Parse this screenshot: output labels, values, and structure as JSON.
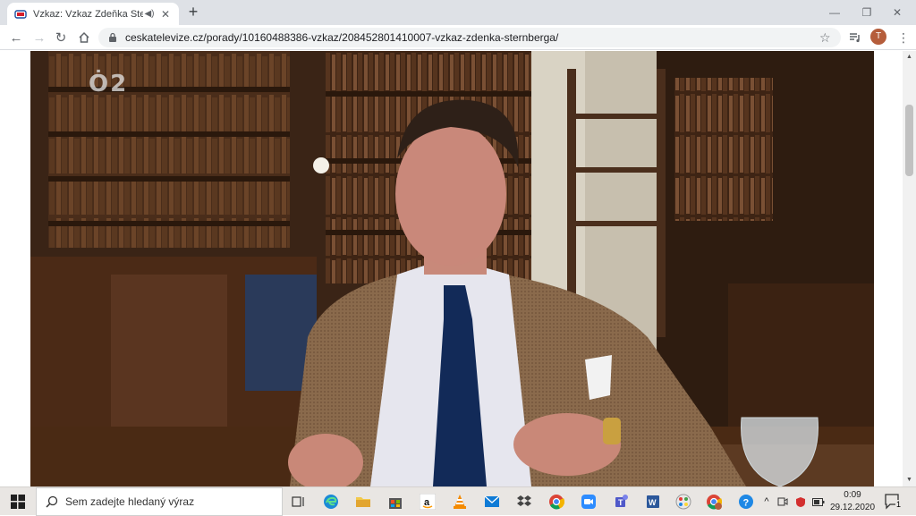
{
  "browser": {
    "tab_title": "Vzkaz: Vzkaz Zdeňka Sternbe",
    "url": "ceskatelevize.cz/porady/10160488386-vzkaz/208452801410007-vzkaz-zdenka-sternberga/",
    "profile_initial": "T",
    "window_controls": [
      "minimize-icon",
      "restore-icon",
      "close-icon"
    ]
  },
  "video": {
    "channel_logo": "Ȯ2"
  },
  "taskbar": {
    "search_placeholder": "Sem zadejte hledaný výraz",
    "apps": [
      "task-view-icon",
      "edge-icon",
      "file-explorer-icon",
      "store-icon",
      "amazon-icon",
      "vlc-icon",
      "mail-icon",
      "dropbox-icon",
      "chrome-icon",
      "zoom-icon",
      "teams-icon",
      "word-icon",
      "paint-icon",
      "chrome-profile-icon",
      "help-icon"
    ],
    "time": "0:09",
    "date": "29.12.2020",
    "notification_count": "1"
  }
}
